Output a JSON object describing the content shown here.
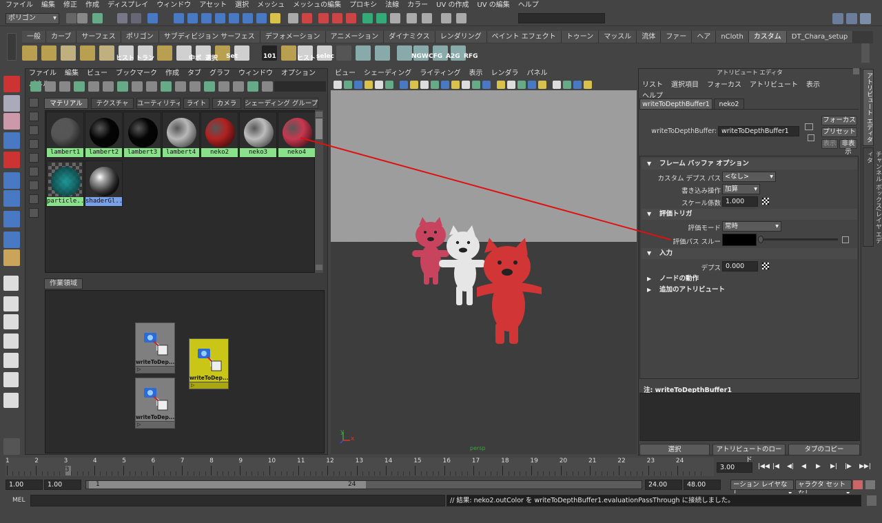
{
  "menubar": [
    "ファイル",
    "編集",
    "修正",
    "作成",
    "ディスプレイ",
    "ウィンドウ",
    "アセット",
    "選択",
    "メッシュ",
    "メッシュの編集",
    "プロキシ",
    "法線",
    "カラー",
    "UV の作成",
    "UV の編集",
    "ヘルプ"
  ],
  "status_line": {
    "mode": "ポリゴン"
  },
  "shelf": {
    "tabs": [
      "一般",
      "カーブ",
      "サーフェス",
      "ポリゴン",
      "サブディビジョン サーフェス",
      "デフォメーション",
      "アニメーション",
      "ダイナミクス",
      "レンダリング",
      "ペイント エフェクト",
      "トゥーン",
      "マッスル",
      "流体",
      "ファー",
      "ヘア",
      "nCloth",
      "カスタム",
      "DT_Chara_setup"
    ],
    "active_tab": "カスタム",
    "button_labels": [
      "ヒスト",
      "トラン",
      "中ボ",
      "選択",
      "Set",
      "101",
      "ヒスト",
      "selec",
      "NGW",
      "CFG",
      "A2G",
      "RFG"
    ]
  },
  "hypershade": {
    "menu": [
      "ファイル",
      "編集",
      "ビュー",
      "ブックマーク",
      "作成",
      "タブ",
      "グラフ",
      "ウィンドウ",
      "オプション",
      "パネル"
    ],
    "tabs": [
      "マテリアル",
      "テクスチャ",
      "ユーティリティ",
      "ライト",
      "カメラ",
      "シェーディング グループ"
    ],
    "active_tab": "マテリアル",
    "materials": [
      {
        "name": "lambert1",
        "color": "#555555"
      },
      {
        "name": "lambert2",
        "color": "#050505"
      },
      {
        "name": "lambert3",
        "color": "#050505"
      },
      {
        "name": "lambert4",
        "color": "#b8b8b8"
      },
      {
        "name": "neko2",
        "color": "#b22222"
      },
      {
        "name": "neko3",
        "color": "#bdbdbd"
      },
      {
        "name": "neko4",
        "color": "#c8384f"
      },
      {
        "name": "particle...",
        "color": "#1a9fa0"
      },
      {
        "name": "shaderGl...",
        "color": "#888888"
      }
    ],
    "work_area_tab": "作業領域",
    "nodes": [
      {
        "label": "writeToDep..."
      },
      {
        "label": "writeToDep..."
      },
      {
        "label": "writeToDep..."
      }
    ]
  },
  "viewport": {
    "menu": [
      "ビュー",
      "シェーディング",
      "ライティング",
      "表示",
      "レンダラ",
      "パネル"
    ],
    "camera_label": "persp",
    "axis": {
      "x": "x",
      "y": "y"
    }
  },
  "attribute_editor": {
    "title": "アトリビュート エディタ",
    "menu": [
      "リスト",
      "選択項目",
      "フォーカス",
      "アトリビュート",
      "表示",
      "ヘルプ"
    ],
    "tabs": [
      "writeToDepthBuffer1",
      "neko2"
    ],
    "active_tab": "writeToDepthBuffer1",
    "node_type_label": "writeToDepthBuffer:",
    "node_name": "writeToDepthBuffer1",
    "buttons": {
      "focus": "フォーカス",
      "presets": "プリセット",
      "show": "表示",
      "hide": "非表示"
    },
    "sections": {
      "framebuffer": {
        "title": "フレーム バッファ オプション",
        "custom_depth_label": "カスタム デプス パス",
        "custom_depth_value": "<なし>",
        "write_op_label": "書き込み操作",
        "write_op_value": "加算",
        "scale_label": "スケール係数",
        "scale_value": "1.000"
      },
      "eval": {
        "title": "評価トリガ",
        "mode_label": "評価モード",
        "mode_value": "常時",
        "pass_label": "評価パス スルー"
      },
      "input": {
        "title": "入力",
        "depth_label": "デプス",
        "depth_value": "0.000"
      },
      "node_behavior": "ノードの動作",
      "extra_attrs": "追加のアトリビュート"
    },
    "notes_label": "注: writeToDepthBuffer1",
    "bottom_buttons": [
      "選択",
      "アトリビュートのロード",
      "タブのコピー"
    ],
    "side_tabs": [
      "アトリビュート エディタ",
      "チャンネル ボックス/レイヤ エディタ"
    ]
  },
  "timeline": {
    "ticks": [
      1,
      2,
      3,
      4,
      5,
      6,
      7,
      8,
      9,
      10,
      11,
      12,
      13,
      14,
      15,
      16,
      17,
      18,
      19,
      20,
      21,
      22,
      23,
      24
    ],
    "current_frame": "3.00",
    "current_marker": "3"
  },
  "range": {
    "start": "1.00",
    "start2": "1.00",
    "range_min": "1",
    "range_max": "24",
    "end": "24.00",
    "end2": "48.00",
    "anim_layer": "ーション レイヤなし",
    "char_set": "ャラクタ セットなし"
  },
  "command_line": {
    "lang": "MEL",
    "result": "// 結果: neko2.outColor を writeToDepthBuffer1.evaluationPassThrough に接続しました。"
  },
  "colors": {
    "connection_line": "#dd1111",
    "cat_red": "#d23535",
    "cat_pink": "#c8435e",
    "cat_white": "#e6e6e6"
  }
}
